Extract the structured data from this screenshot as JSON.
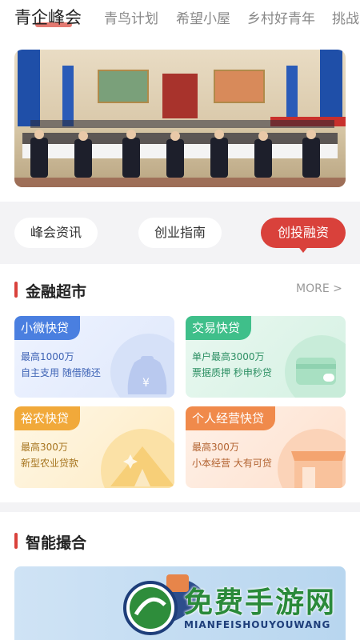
{
  "tabs": [
    {
      "label": "青企峰会",
      "active": true
    },
    {
      "label": "青鸟计划",
      "active": false
    },
    {
      "label": "希望小屋",
      "active": false
    },
    {
      "label": "乡村好青年",
      "active": false
    },
    {
      "label": "挑战",
      "active": false
    }
  ],
  "pills": [
    {
      "label": "峰会资讯",
      "active": false
    },
    {
      "label": "创业指南",
      "active": false
    },
    {
      "label": "创投融资",
      "active": true
    }
  ],
  "finance": {
    "title": "金融超市",
    "more": "MORE >",
    "cards": [
      {
        "tag": "小微快贷",
        "line1": "最高1000万",
        "line2": "自主支用 随借随还"
      },
      {
        "tag": "交易快贷",
        "line1": "单户最高3000万",
        "line2": "票据质押 秒申秒贷"
      },
      {
        "tag": "裕农快贷",
        "line1": "最高300万",
        "line2": "新型农业贷款"
      },
      {
        "tag": "个人经营快贷",
        "line1": "最高300万",
        "line2": "小本经营 大有可贷"
      }
    ]
  },
  "match": {
    "title": "智能撮合"
  },
  "watermark": {
    "cn": "免费手游网",
    "en": "MIANFEISHOUYOUWANG"
  },
  "colors": {
    "accent": "#d9413b",
    "blue_tag": "#4a7fe0",
    "green_tag": "#3fbf8a",
    "orange_tag": "#f1a93a",
    "coral_tag": "#f08a4b"
  }
}
